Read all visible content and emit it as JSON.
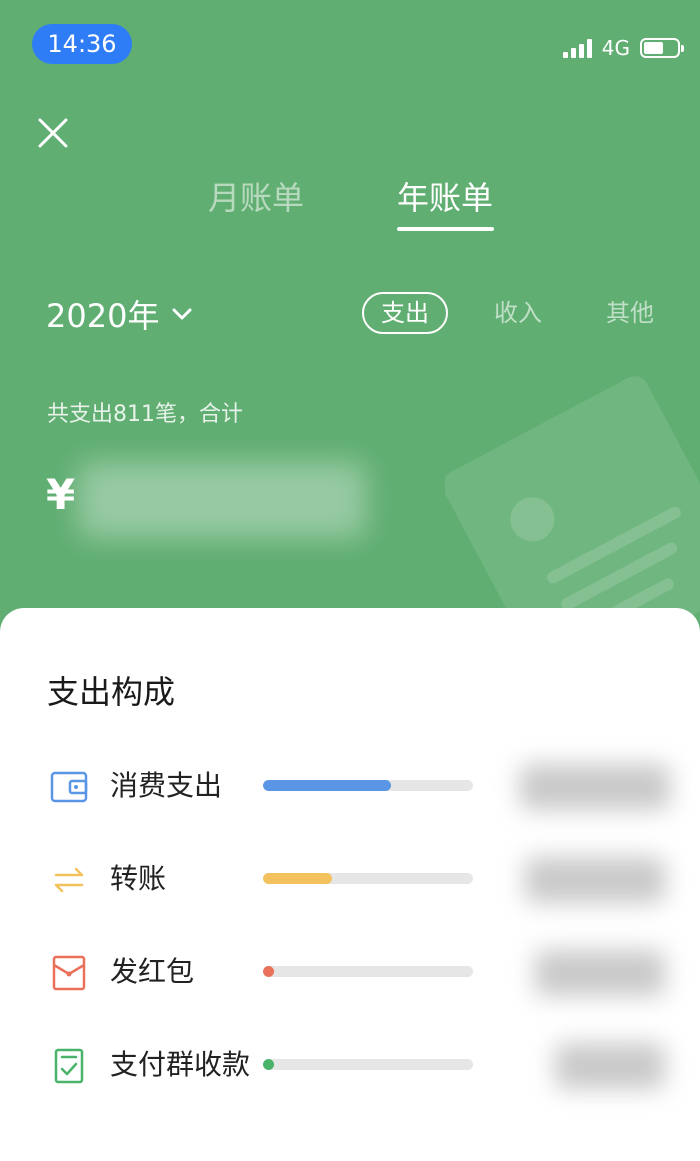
{
  "status_bar": {
    "time": "14:36",
    "network": "4G"
  },
  "tabs": [
    {
      "label": "月账单",
      "active": false
    },
    {
      "label": "年账单",
      "active": true
    }
  ],
  "year_select": {
    "label": "2020年"
  },
  "type_filter": [
    {
      "label": "支出",
      "active": true
    },
    {
      "label": "收入",
      "active": false
    },
    {
      "label": "其他",
      "active": false
    }
  ],
  "summary": {
    "text": "共支出811笔，合计",
    "currency": "¥"
  },
  "card": {
    "title": "支出构成",
    "items": [
      {
        "label": "消费支出",
        "icon": "wallet-icon",
        "color": "#5b96e6",
        "share": 0.61
      },
      {
        "label": "转账",
        "icon": "transfer-icon",
        "color": "#f3c25e",
        "share": 0.33
      },
      {
        "label": "发红包",
        "icon": "red-packet-icon",
        "color": "#e9715a",
        "share": 0.04
      },
      {
        "label": "支付群收款",
        "icon": "checklist-icon",
        "color": "#49b36a",
        "share": 0.03
      }
    ]
  },
  "colors": {
    "header_bg": "#60ae72",
    "time_pill": "#2f7df6"
  }
}
